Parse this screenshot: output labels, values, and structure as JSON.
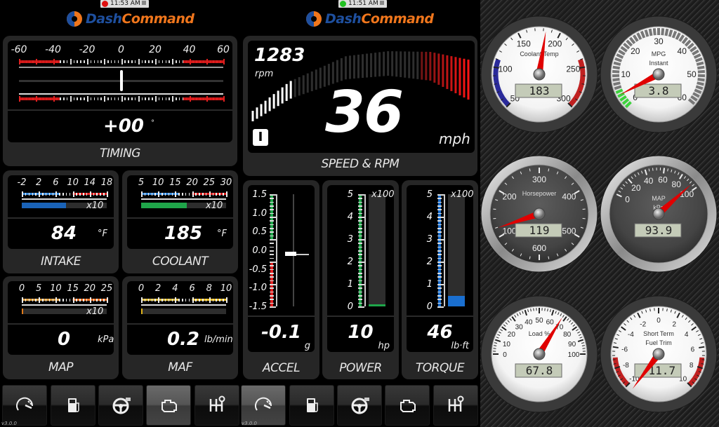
{
  "left": {
    "clock": "11:53 AM",
    "clock_dot_color": "#e01010",
    "logo": {
      "dash": "Dash",
      "command": "Command"
    },
    "timing": {
      "label": "TIMING",
      "value": "+00",
      "unit": "°",
      "scale": [
        "-60",
        "-40",
        "-20",
        "0",
        "20",
        "40",
        "60"
      ],
      "range": [
        -60,
        60
      ],
      "reading": 0
    },
    "intake": {
      "label": "INTAKE",
      "value": "84",
      "unit": "°F",
      "scale": [
        "-2",
        "2",
        "6",
        "10",
        "14",
        "18"
      ],
      "multiplier": "x10",
      "fill_fraction": 0.52,
      "fill_color": "#1a63b8"
    },
    "coolant": {
      "label": "COOLANT",
      "value": "185",
      "unit": "°F",
      "scale": [
        "5",
        "10",
        "15",
        "20",
        "25",
        "30"
      ],
      "multiplier": "x10",
      "fill_fraction": 0.54,
      "fill_color": "#1fa64a"
    },
    "map": {
      "label": "MAP",
      "value": "0",
      "unit": "kPa",
      "scale": [
        "0",
        "5",
        "10",
        "15",
        "20",
        "25"
      ],
      "multiplier": "x10",
      "fill_fraction": 0,
      "fill_color": "#e07a1a"
    },
    "maf": {
      "label": "MAF",
      "value": "0.2",
      "unit": "lb/min",
      "scale": [
        "0",
        "2",
        "4",
        "6",
        "8",
        "10"
      ],
      "multiplier": "",
      "fill_fraction": 0.02,
      "fill_color": "#e0b41a"
    },
    "version": "v3.0.0"
  },
  "middle": {
    "clock": "11:51 AM",
    "clock_dot_color": "#22c022",
    "logo": {
      "dash": "Dash",
      "command": "Command"
    },
    "speed": {
      "label": "SPEED & RPM",
      "rpm": "1283",
      "rpm_unit": "rpm",
      "speed": "36",
      "speed_unit": "mph",
      "gear": "I",
      "rpm_fraction": 0.19
    },
    "accel": {
      "label": "ACCEL",
      "value": "-0.1",
      "unit": "g",
      "scale": [
        "1.5",
        "1.0",
        "0.5",
        "0.0",
        "-0.5",
        "-1.0",
        "-1.5"
      ],
      "range": [
        -1.5,
        1.5
      ],
      "reading": -0.1
    },
    "power": {
      "label": "POWER",
      "value": "10",
      "unit": "hp",
      "scale": [
        "5",
        "4",
        "3",
        "2",
        "1",
        "0"
      ],
      "multiplier": "x100",
      "fill_fraction": 0.02,
      "fill_color": "#1fa64a"
    },
    "torque": {
      "label": "TORQUE",
      "value": "46",
      "unit": "lb·ft",
      "scale": [
        "5",
        "4",
        "3",
        "2",
        "1",
        "0"
      ],
      "multiplier": "x100",
      "fill_fraction": 0.092,
      "fill_color": "#1a6fd0"
    },
    "version": "v3.0.0"
  },
  "nav": {
    "items": [
      {
        "icon": "speedometer-icon",
        "label": "Gauges"
      },
      {
        "icon": "fuel-pump-icon",
        "label": "Fuel"
      },
      {
        "icon": "steering-wheel-icon",
        "label": "Driving"
      },
      {
        "icon": "engine-icon",
        "label": "Engine"
      },
      {
        "icon": "gear-shift-icon",
        "label": "Transmission"
      }
    ],
    "left_active": 3,
    "middle_active": 0
  },
  "gauges": [
    {
      "name": "coolant-temp",
      "title": [
        "Coolant Temp"
      ],
      "display": "183",
      "value": 183,
      "min": 50,
      "max": 300,
      "labels": [
        "50",
        "100",
        "150",
        "200",
        "250",
        "300"
      ],
      "face": "light",
      "bezel": "dark",
      "zones": [
        {
          "from": 50,
          "to": 110,
          "color": "#2a2a9a"
        },
        {
          "from": 240,
          "to": 300,
          "color": "#c02020"
        }
      ]
    },
    {
      "name": "mpg-instant",
      "title": [
        "MPG",
        "Instant"
      ],
      "display": "3.8",
      "value": 3.8,
      "min": 0,
      "max": 60,
      "labels": [
        "0",
        "10",
        "20",
        "30",
        "40",
        "50",
        "60"
      ],
      "face": "light",
      "bezel": "dark",
      "segments": true
    },
    {
      "name": "horsepower",
      "title": [
        "Horsepower"
      ],
      "display": "119",
      "value": 119,
      "min": 0,
      "max": 600,
      "labels": [
        "0",
        "100",
        "200",
        "300",
        "400",
        "500",
        "600"
      ],
      "face": "dark",
      "bezel": "chrome"
    },
    {
      "name": "map-kpa",
      "title": [
        "MAP",
        "kPa"
      ],
      "display": "93.9",
      "value": 93.9,
      "min": 0,
      "max": 100,
      "labels": [
        "0",
        "20",
        "40",
        "60",
        "80",
        "100"
      ],
      "face": "dark",
      "bezel": "chrome"
    },
    {
      "name": "load",
      "title": [
        "Load %"
      ],
      "display": "67.8",
      "value": 67.8,
      "min": 0,
      "max": 100,
      "labels": [
        "0",
        "10",
        "20",
        "30",
        "40",
        "50",
        "60",
        "70",
        "80",
        "90",
        "100"
      ],
      "face": "light",
      "bezel": "dark"
    },
    {
      "name": "short-term-fuel-trim",
      "title": [
        "Short Term",
        "Fuel Trim"
      ],
      "display": "-11.7",
      "value": -11.7,
      "min": -10,
      "max": 10,
      "labels": [
        "-10",
        "-8",
        "-6",
        "-4",
        "-2",
        "0",
        "2",
        "4",
        "6",
        "8",
        "10"
      ],
      "face": "light",
      "bezel": "dark",
      "zones": [
        {
          "from": -10,
          "to": -7,
          "color": "#c02020"
        },
        {
          "from": 7,
          "to": 10,
          "color": "#c02020"
        }
      ]
    }
  ]
}
